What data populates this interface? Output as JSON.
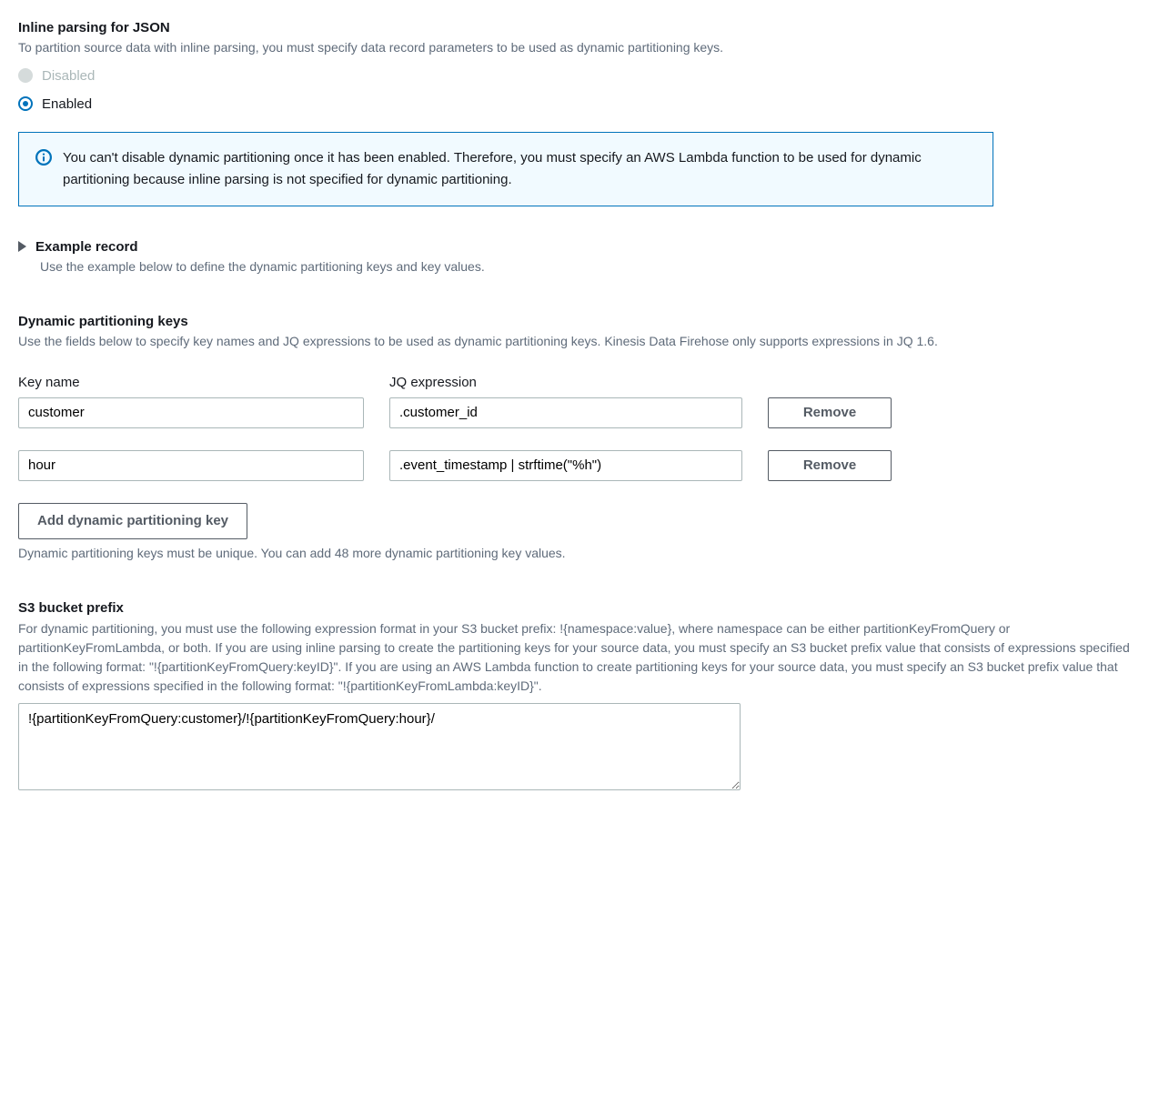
{
  "inlineParsing": {
    "title": "Inline parsing for JSON",
    "description": "To partition source data with inline parsing, you must specify data record parameters to be used as dynamic partitioning keys.",
    "disabledLabel": "Disabled",
    "enabledLabel": "Enabled"
  },
  "infoBox": {
    "text": "You can't disable dynamic partitioning once it has been enabled. Therefore, you must specify an AWS Lambda function to be used for dynamic partitioning because inline parsing is not specified for dynamic partitioning."
  },
  "exampleRecord": {
    "title": "Example record",
    "description": "Use the example below to define the dynamic partitioning keys and key values."
  },
  "partitionKeys": {
    "title": "Dynamic partitioning keys",
    "description": "Use the fields below to specify key names and JQ expressions to be used as dynamic partitioning keys. Kinesis Data Firehose only supports expressions in JQ 1.6.",
    "keyNameHeader": "Key name",
    "jqHeader": "JQ expression",
    "removeLabel": "Remove",
    "addLabel": "Add dynamic partitioning key",
    "hint": "Dynamic partitioning keys must be unique. You can add 48 more dynamic partitioning key values.",
    "rows": [
      {
        "keyName": "customer",
        "jq": ".customer_id"
      },
      {
        "keyName": "hour",
        "jq": ".event_timestamp | strftime(\"%h\")"
      }
    ]
  },
  "s3Prefix": {
    "title": "S3 bucket prefix",
    "description": "For dynamic partitioning, you must use the following expression format in your S3 bucket prefix: !{namespace:value}, where namespace can be either partitionKeyFromQuery or partitionKeyFromLambda, or both. If you are using inline parsing to create the partitioning keys for your source data, you must specify an S3 bucket prefix value that consists of expressions specified in the following format: \"!{partitionKeyFromQuery:keyID}\". If you are using an AWS Lambda function to create partitioning keys for your source data, you must specify an S3 bucket prefix value that consists of expressions specified in the following format: \"!{partitionKeyFromLambda:keyID}\".",
    "value": "!{partitionKeyFromQuery:customer}/!{partitionKeyFromQuery:hour}/"
  }
}
